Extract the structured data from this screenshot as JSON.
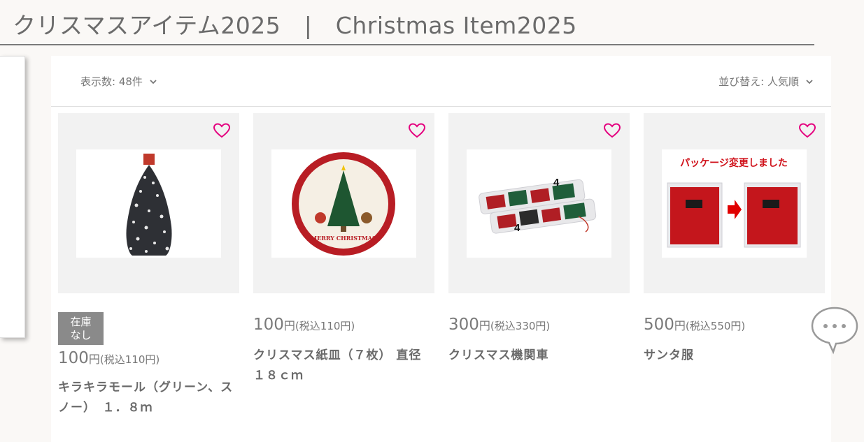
{
  "header": {
    "title": "クリスマスアイテム2025　|　Christmas Item2025"
  },
  "toolbar": {
    "per_page_label": "表示数: 48件",
    "sort_label": "並び替え: 人気順"
  },
  "products": [
    {
      "name": "キラキラモール（グリーン、スノー）　１．８ｍ",
      "price": "100",
      "currency": "円",
      "tax_note": "(税込110円)",
      "stock_badge": "在庫なし",
      "image": "silver tinsel garland"
    },
    {
      "name": "クリスマス紙皿（７枚） 直径１８ｃｍ",
      "price": "100",
      "currency": "円",
      "tax_note": "(税込110円)",
      "image": "paper plate with christmas tree",
      "image_text": "MERRY CHRISTMAS"
    },
    {
      "name": "クリスマス機関車",
      "price": "300",
      "currency": "円",
      "tax_note": "(税込330円)",
      "image": "toy train packages",
      "image_labels": [
        "4",
        "4"
      ]
    },
    {
      "name": "サンタ服",
      "price": "500",
      "currency": "円",
      "tax_note": "(税込550円)",
      "image": "santa costume packages",
      "image_banner": "パッケージ変更しました"
    }
  ],
  "colors": {
    "heart": "#e4007f",
    "badge": "#8a8a8a",
    "title": "#6b6b6b"
  },
  "icons": {
    "favorite": "heart-outline-icon",
    "chat": "chat-bubble-icon",
    "dropdown": "chevron-down-icon"
  }
}
